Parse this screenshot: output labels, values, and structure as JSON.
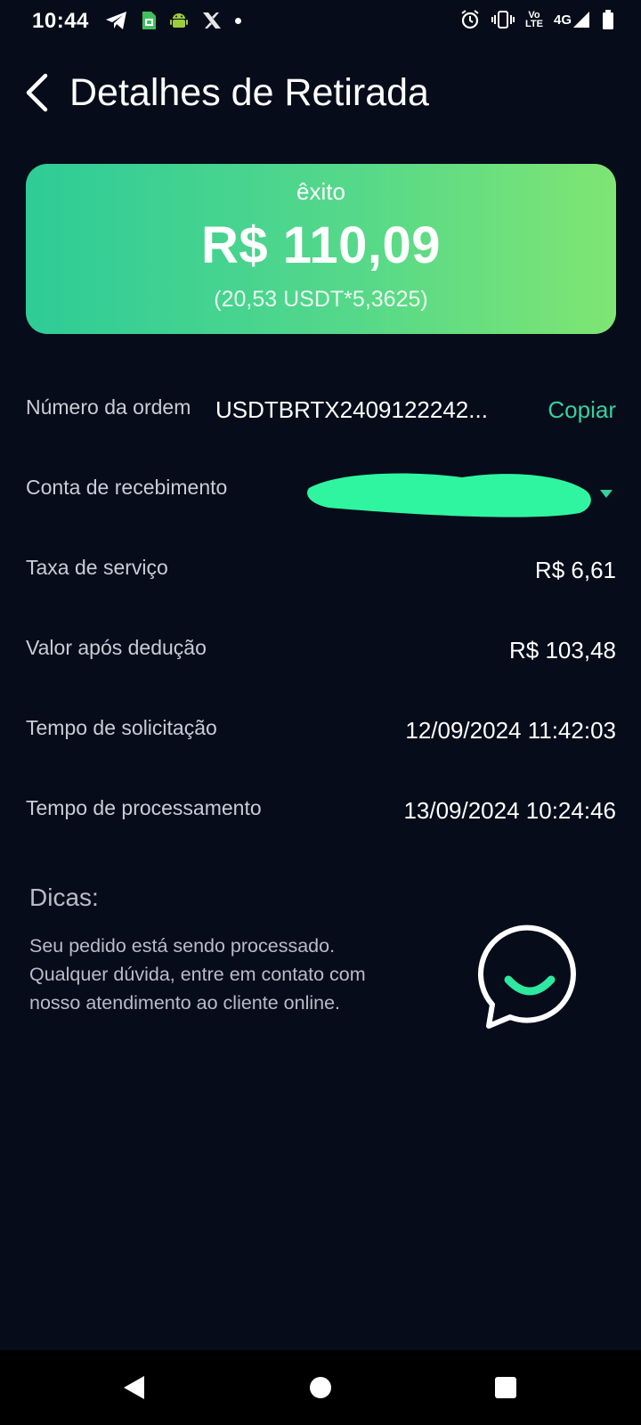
{
  "status_bar": {
    "time": "10:44",
    "left_icons": [
      "telegram-icon",
      "sim-app-icon",
      "android-icon",
      "x-app-icon",
      "notification-dot-icon"
    ],
    "right_icons": [
      "alarm-icon",
      "vibrate-icon",
      "volte-icon",
      "signal-icon",
      "battery-icon"
    ],
    "volte_top": "Vo",
    "volte_bottom": "LTE",
    "network": "4G"
  },
  "header": {
    "title": "Detalhes de Retirada",
    "back_icon": "chevron-left-icon"
  },
  "status_card": {
    "label": "êxito",
    "amount": "R$ 110,09",
    "conversion": "(20,53 USDT*5,3625)",
    "colors": {
      "start": "#2ecc97",
      "end": "#7fe573"
    }
  },
  "details": {
    "order_number": {
      "label": "Número da ordem",
      "value": "USDTBRTX2409122242...",
      "copy_label": "Copiar"
    },
    "receiving_account": {
      "label": "Conta de recebimento",
      "value": "",
      "redacted": true
    },
    "service_fee": {
      "label": "Taxa de serviço",
      "value": "R$ 6,61"
    },
    "net_value": {
      "label": "Valor após dedução",
      "value": "R$ 103,48"
    },
    "request_time": {
      "label": "Tempo de solicitação",
      "value": "12/09/2024 11:42:03"
    },
    "processing_time": {
      "label": "Tempo de processamento",
      "value": "13/09/2024 10:24:46"
    }
  },
  "tips": {
    "title": "Dicas:",
    "text": "Seu pedido está sendo processado. Qualquer dúvida, entre em contato com nosso atendimento ao cliente online.",
    "chat_icon": "chat-support-icon"
  },
  "navbar": {
    "icons": [
      "nav-back-icon",
      "nav-home-icon",
      "nav-recents-icon"
    ]
  },
  "colors": {
    "background": "#070c1a",
    "accent": "#35d0a0",
    "redaction": "#2ff5a0"
  }
}
